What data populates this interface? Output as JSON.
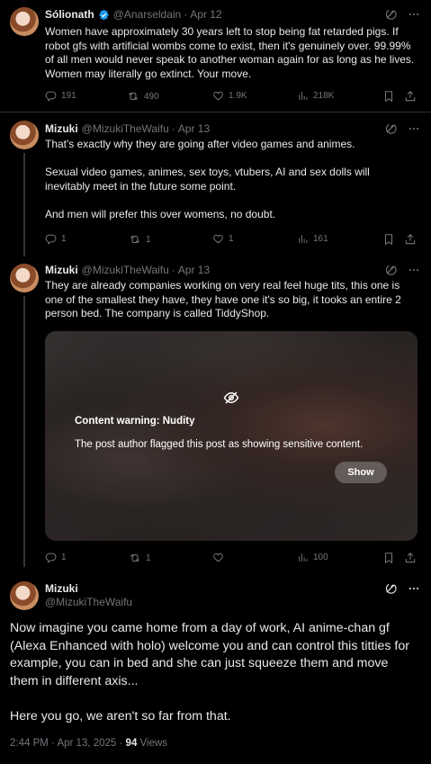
{
  "posts": [
    {
      "name": "Sólionath",
      "handle": "@Anarseldain",
      "sep": "·",
      "date": "Apr 12",
      "text": "Women have approximately 30 years left to stop being fat retarded pigs. If robot gfs with artificial wombs come to exist, then it's genuinely over. 99.99% of all men would never speak to another woman again for as long as he lives. Women may literally go extinct. Your move.",
      "replies": "191",
      "reposts": "490",
      "likes": "1.9K",
      "views": "218K"
    },
    {
      "name": "Mizuki",
      "handle": "@MizukiTheWaifu",
      "sep": "·",
      "date": "Apr 13",
      "text": "That's exactly why they are going after video games and animes.\n\nSexual video games, animes, sex toys, vtubers, AI and sex dolls will inevitably meet in the future some point.\n\nAnd men will prefer this over womens, no doubt.",
      "replies": "1",
      "reposts": "1",
      "likes": "1",
      "views": "161"
    },
    {
      "name": "Mizuki",
      "handle": "@MizukiTheWaifu",
      "sep": "·",
      "date": "Apr 13",
      "text": "They are already companies working on very real feel huge tits, this one is one of the smallest they have, they have one it's so big, it tooks an entire 2 person bed. The company is called TiddyShop.",
      "media": {
        "warning_title": "Content warning: Nudity",
        "warning_desc": "The post author flagged this post as showing sensitive content.",
        "show_label": "Show"
      },
      "replies": "1",
      "reposts": "1",
      "likes": "",
      "views": "100"
    }
  ],
  "main_post": {
    "name": "Mizuki",
    "handle": "@MizukiTheWaifu",
    "text": "Now imagine you came home from a day of work, AI anime-chan gf (Alexa Enhanced with holo) welcome you and can control this titties for example, you can in bed and she can just squeeze them and move them in different axis...\n\nHere you go, we aren't so far from that.",
    "time": "2:44 PM",
    "sep": "·",
    "date": "Apr 13, 2025",
    "sep2": "·",
    "views_count": "94",
    "views_label": "Views"
  },
  "colors": {
    "accent": "#1d9bf0",
    "muted": "#71767b",
    "text": "#e7e9ea",
    "bg": "#000000"
  },
  "icons": [
    "grok-icon",
    "more-icon",
    "reply-icon",
    "repost-icon",
    "like-icon",
    "views-icon",
    "bookmark-icon",
    "share-icon",
    "verified-icon",
    "eye-off-icon"
  ]
}
